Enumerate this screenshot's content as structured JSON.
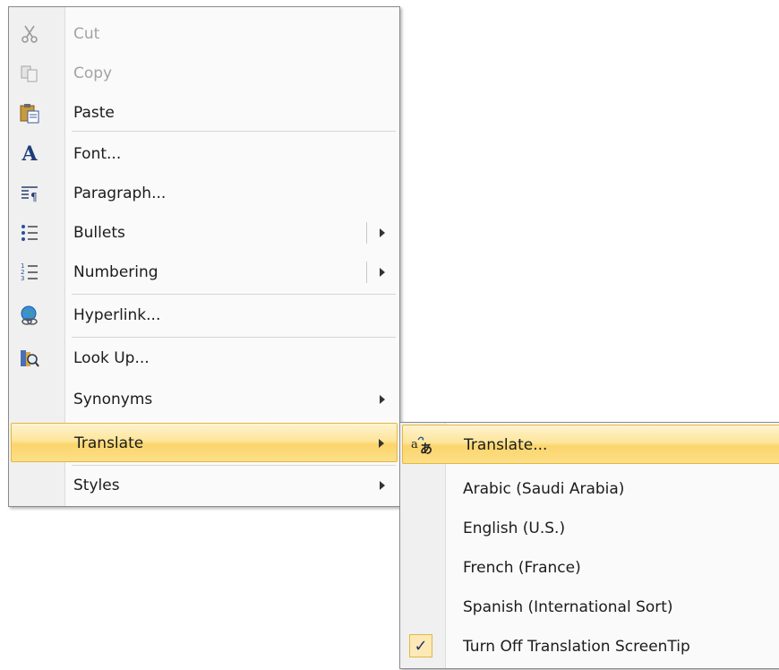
{
  "main_menu": {
    "items": [
      {
        "label": "Cut",
        "icon": "scissors-icon",
        "disabled": true
      },
      {
        "label": "Copy",
        "icon": "copy-icon",
        "disabled": true
      },
      {
        "label": "Paste",
        "icon": "paste-icon",
        "disabled": false
      },
      {
        "label": "Font...",
        "icon": "font-icon",
        "disabled": false
      },
      {
        "label": "Paragraph...",
        "icon": "paragraph-icon",
        "disabled": false
      },
      {
        "label": "Bullets",
        "icon": "bullets-icon",
        "disabled": false
      },
      {
        "label": "Numbering",
        "icon": "numbering-icon",
        "disabled": false
      },
      {
        "label": "Hyperlink...",
        "icon": "hyperlink-icon",
        "disabled": false
      },
      {
        "label": "Look Up...",
        "icon": "research-icon",
        "disabled": false
      },
      {
        "label": "Synonyms",
        "icon": "",
        "disabled": false
      },
      {
        "label": "Translate",
        "icon": "",
        "disabled": false,
        "highlighted": true
      },
      {
        "label": "Styles",
        "icon": "",
        "disabled": false
      }
    ]
  },
  "translate_submenu": {
    "items": [
      {
        "label": "Translate...",
        "icon": "translate-icon",
        "highlighted": true
      },
      {
        "label": "Arabic (Saudi Arabia)"
      },
      {
        "label": "English (U.S.)"
      },
      {
        "label": "French (France)"
      },
      {
        "label": "Spanish (International Sort)"
      },
      {
        "label": "Turn Off Translation ScreenTip",
        "checked": true,
        "check_glyph": "✓"
      }
    ]
  },
  "colors": {
    "highlight": "#fbd56c",
    "highlight_border": "#e4b742",
    "disabled_text": "#a3a3a3"
  }
}
